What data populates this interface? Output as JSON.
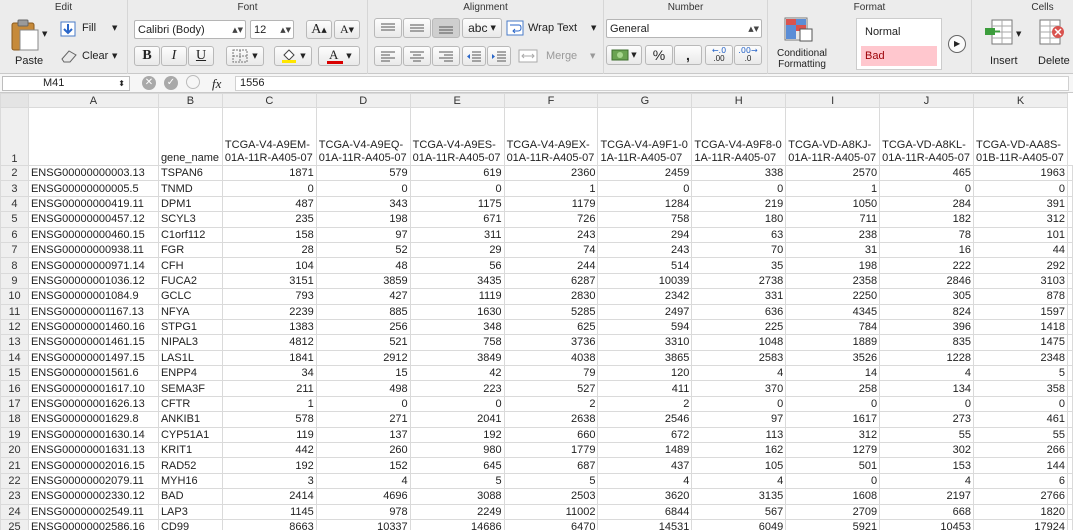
{
  "ribbon": {
    "groups": {
      "edit": "Edit",
      "font": "Font",
      "alignment": "Alignment",
      "number": "Number",
      "format": "Format",
      "cells": "Cells"
    },
    "paste_label": "Paste",
    "fill_label": "Fill",
    "clear_label": "Clear",
    "font_name": "Calibri (Body)",
    "font_size": "12",
    "bold": "B",
    "italic": "I",
    "underline": "U",
    "increase_font": "A",
    "decrease_font": "A",
    "abc_label": "abc",
    "wrap_text_label": "Wrap Text",
    "merge_label": "Merge",
    "number_format": "General",
    "percent_label": "%",
    "comma_label": ",",
    "inc_decimal_label": ".00",
    "dec_decimal_label": ".0",
    "conditional_formatting_label": "Conditional Formatting",
    "style_normal": "Normal",
    "style_bad": "Bad",
    "insert_label": "Insert",
    "delete_label": "Delete",
    "colors": {
      "font_red": "#d90000",
      "fill_yellow": "#ffe600",
      "bad_bg": "#ffc7ce",
      "bad_text": "#9c0006"
    }
  },
  "formula_bar": {
    "cell_ref": "M41",
    "fx_label": "fx",
    "value": "1556"
  },
  "sheet": {
    "columns": [
      "A",
      "B",
      "C",
      "D",
      "E",
      "F",
      "G",
      "H",
      "I",
      "J",
      "K"
    ],
    "header_row": [
      "",
      "gene_name",
      "TCGA-V4-A9EM-01A-11R-A405-07",
      "TCGA-V4-A9EQ-01A-11R-A405-07",
      "TCGA-V4-A9ES-01A-11R-A405-07",
      "TCGA-V4-A9EX-01A-11R-A405-07",
      "TCGA-V4-A9F1-01A-11R-A405-07",
      "TCGA-V4-A9F8-01A-11R-A405-07",
      "TCGA-VD-A8KJ-01A-11R-A405-07",
      "TCGA-VD-A8KL-01A-11R-A405-07",
      "TCGA-VD-AA8S-01B-11R-A405-07"
    ],
    "rows": [
      [
        "ENSG00000000003.13",
        "TSPAN6",
        "1871",
        "579",
        "619",
        "2360",
        "2459",
        "338",
        "2570",
        "465",
        "1963"
      ],
      [
        "ENSG00000000005.5",
        "TNMD",
        "0",
        "0",
        "0",
        "1",
        "0",
        "0",
        "1",
        "0",
        "0"
      ],
      [
        "ENSG00000000419.11",
        "DPM1",
        "487",
        "343",
        "1175",
        "1179",
        "1284",
        "219",
        "1050",
        "284",
        "391"
      ],
      [
        "ENSG00000000457.12",
        "SCYL3",
        "235",
        "198",
        "671",
        "726",
        "758",
        "180",
        "711",
        "182",
        "312"
      ],
      [
        "ENSG00000000460.15",
        "C1orf112",
        "158",
        "97",
        "311",
        "243",
        "294",
        "63",
        "238",
        "78",
        "101"
      ],
      [
        "ENSG00000000938.11",
        "FGR",
        "28",
        "52",
        "29",
        "74",
        "243",
        "70",
        "31",
        "16",
        "44"
      ],
      [
        "ENSG00000000971.14",
        "CFH",
        "104",
        "48",
        "56",
        "244",
        "514",
        "35",
        "198",
        "222",
        "292"
      ],
      [
        "ENSG00000001036.12",
        "FUCA2",
        "3151",
        "3859",
        "3435",
        "6287",
        "10039",
        "2738",
        "2358",
        "2846",
        "3103"
      ],
      [
        "ENSG00000001084.9",
        "GCLC",
        "793",
        "427",
        "1119",
        "2830",
        "2342",
        "331",
        "2250",
        "305",
        "878"
      ],
      [
        "ENSG00000001167.13",
        "NFYA",
        "2239",
        "885",
        "1630",
        "5285",
        "2497",
        "636",
        "4345",
        "824",
        "1597"
      ],
      [
        "ENSG00000001460.16",
        "STPG1",
        "1383",
        "256",
        "348",
        "625",
        "594",
        "225",
        "784",
        "396",
        "1418"
      ],
      [
        "ENSG00000001461.15",
        "NIPAL3",
        "4812",
        "521",
        "758",
        "3736",
        "3310",
        "1048",
        "1889",
        "835",
        "1475"
      ],
      [
        "ENSG00000001497.15",
        "LAS1L",
        "1841",
        "2912",
        "3849",
        "4038",
        "3865",
        "2583",
        "3526",
        "1228",
        "2348"
      ],
      [
        "ENSG00000001561.6",
        "ENPP4",
        "34",
        "15",
        "42",
        "79",
        "120",
        "4",
        "14",
        "4",
        "5"
      ],
      [
        "ENSG00000001617.10",
        "SEMA3F",
        "211",
        "498",
        "223",
        "527",
        "411",
        "370",
        "258",
        "134",
        "358"
      ],
      [
        "ENSG00000001626.13",
        "CFTR",
        "1",
        "0",
        "0",
        "2",
        "2",
        "0",
        "0",
        "0",
        "0"
      ],
      [
        "ENSG00000001629.8",
        "ANKIB1",
        "578",
        "271",
        "2041",
        "2638",
        "2546",
        "97",
        "1617",
        "273",
        "461"
      ],
      [
        "ENSG00000001630.14",
        "CYP51A1",
        "119",
        "137",
        "192",
        "660",
        "672",
        "113",
        "312",
        "55",
        "55"
      ],
      [
        "ENSG00000001631.13",
        "KRIT1",
        "442",
        "260",
        "980",
        "1779",
        "1489",
        "162",
        "1279",
        "302",
        "266"
      ],
      [
        "ENSG00000002016.15",
        "RAD52",
        "192",
        "152",
        "645",
        "687",
        "437",
        "105",
        "501",
        "153",
        "144"
      ],
      [
        "ENSG00000002079.11",
        "MYH16",
        "3",
        "4",
        "5",
        "5",
        "4",
        "4",
        "0",
        "4",
        "6"
      ],
      [
        "ENSG00000002330.12",
        "BAD",
        "2414",
        "4696",
        "3088",
        "2503",
        "3620",
        "3135",
        "1608",
        "2197",
        "2766"
      ],
      [
        "ENSG00000002549.11",
        "LAP3",
        "1145",
        "978",
        "2249",
        "11002",
        "6844",
        "567",
        "2709",
        "668",
        "1820"
      ],
      [
        "ENSG00000002586.16",
        "CD99",
        "8663",
        "10337",
        "14686",
        "6470",
        "14531",
        "6049",
        "5921",
        "10453",
        "17924"
      ]
    ]
  }
}
